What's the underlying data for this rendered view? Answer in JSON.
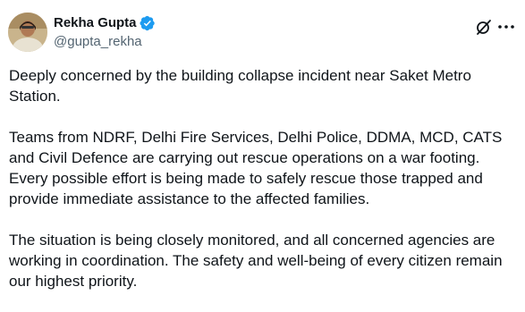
{
  "author": {
    "display_name": "Rekha Gupta",
    "handle": "@gupta_rekha"
  },
  "post": {
    "paragraphs": [
      "Deeply concerned by the building collapse incident near Saket Metro Station.",
      "Teams from NDRF, Delhi Fire Services, Delhi Police, DDMA, MCD, CATS and Civil Defence are carrying out rescue operations on a war footing. Every possible effort is being made to safely rescue those trapped and provide immediate assistance to the affected families.",
      "The situation is being closely monitored, and all concerned agencies are working in coordination. The safety and well-being of every citizen remain our highest priority."
    ]
  },
  "icons": {
    "verified": "verified-badge-icon",
    "grok": "grok-icon",
    "more": "more-options-icon"
  },
  "colors": {
    "text_primary": "#0f1419",
    "text_secondary": "#536471",
    "verified_blue": "#1d9bf0"
  }
}
